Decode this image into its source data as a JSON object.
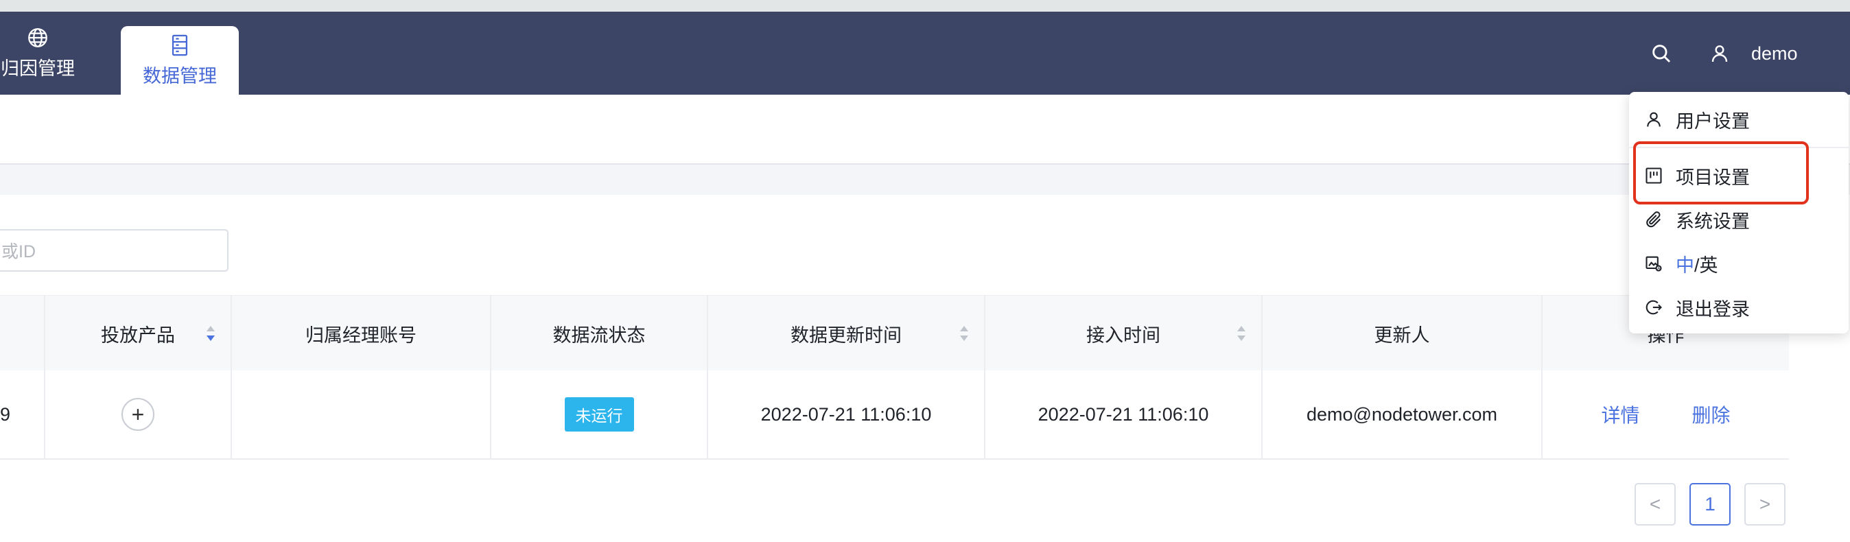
{
  "nav": {
    "items": [
      {
        "label": "归因管理",
        "icon": "globe-icon",
        "active": false
      },
      {
        "label": "数据管理",
        "icon": "database-icon",
        "active": true
      }
    ],
    "right": {
      "search_icon": "search-icon",
      "user_icon": "user-icon",
      "username": "demo"
    }
  },
  "search": {
    "placeholder": "或ID"
  },
  "table": {
    "columns": [
      {
        "label": "",
        "sortable": false
      },
      {
        "label": "投放产品",
        "sortable": true
      },
      {
        "label": "归属经理账号",
        "sortable": false
      },
      {
        "label": "数据流状态",
        "sortable": false
      },
      {
        "label": "数据更新时间",
        "sortable": true
      },
      {
        "label": "接入时间",
        "sortable": true
      },
      {
        "label": "更新人",
        "sortable": false
      },
      {
        "label": "操作",
        "sortable": false
      }
    ],
    "rows": [
      {
        "id_fragment": "9",
        "product_add": "+",
        "manager_account": "",
        "status": "未运行",
        "updated_at": "2022-07-21 11:06:10",
        "accessed_at": "2022-07-21 11:06:10",
        "updater": "demo@nodetower.com",
        "actions": {
          "detail": "详情",
          "delete": "删除"
        }
      }
    ]
  },
  "pagination": {
    "prev": "<",
    "current": "1",
    "next": ">"
  },
  "user_menu": {
    "items": [
      {
        "label": "用户设置",
        "icon": "user-icon"
      },
      {
        "label": "项目设置",
        "icon": "project-icon"
      },
      {
        "label": "系统设置",
        "icon": "paperclip-icon"
      },
      {
        "label_zh": "中",
        "label_sep": "/英",
        "icon": "language-icon"
      },
      {
        "label": "退出登录",
        "icon": "logout-icon"
      }
    ]
  },
  "colors": {
    "navbar": "#3d4566",
    "accent": "#4b73e0",
    "status_badge": "#2bb5ec",
    "highlight": "#e0321c"
  }
}
